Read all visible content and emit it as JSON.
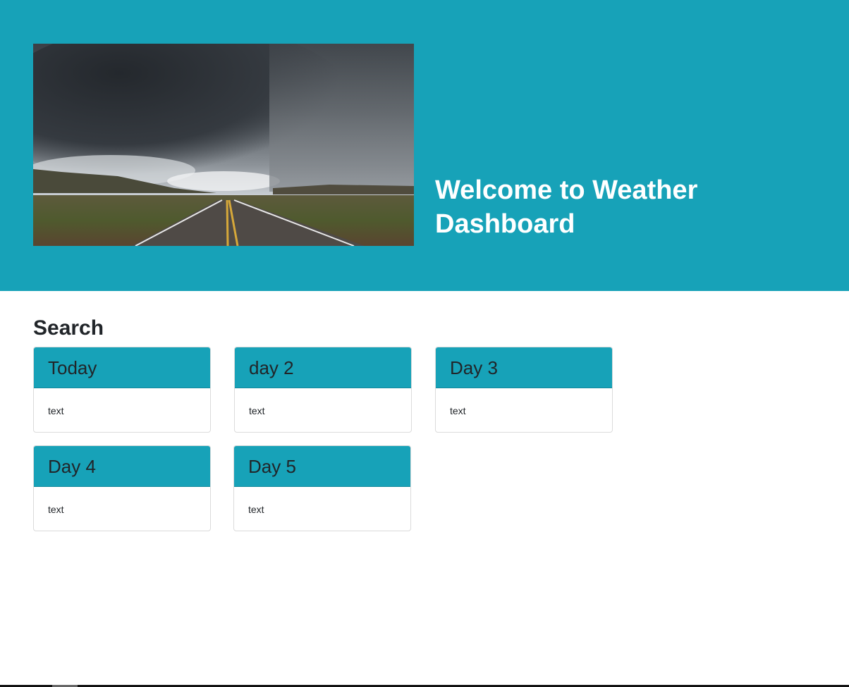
{
  "hero": {
    "image_name": "storm-over-road-photo",
    "title": "Welcome to Weather Dashboard",
    "background_color": "#17a2b8"
  },
  "search": {
    "heading": "Search"
  },
  "forecast": {
    "cards": [
      {
        "title": "Today",
        "text": "text"
      },
      {
        "title": "day 2",
        "text": "text"
      },
      {
        "title": "Day 3",
        "text": "text"
      },
      {
        "title": "Day 4",
        "text": "text"
      },
      {
        "title": "Day 5",
        "text": "text"
      }
    ],
    "header_color": "#17a2b8"
  }
}
